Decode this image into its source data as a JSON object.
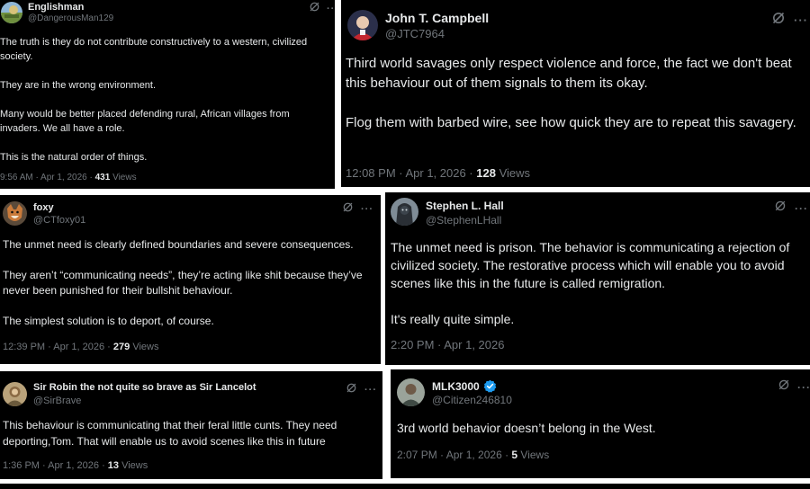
{
  "colors": {
    "background": "#000000",
    "text": "#e7e9ea",
    "muted": "#71767b",
    "verified_badge": "#1d9bf0",
    "gap": "#ffffff"
  },
  "icons": {
    "grok": "grok-icon",
    "more": "more-options-icon",
    "verified": "verified-badge-icon"
  },
  "tweets": [
    {
      "name": "Englishman",
      "handle": "@DangerousMan129",
      "paragraphs": [
        "The truth is they do not contribute constructively to a western, civilized society.",
        "They are in the wrong environment.",
        "Many would be better placed defending rural, African villages from invaders. We all have a role.",
        "This is the natural order of things."
      ],
      "time": "9:56 AM · Apr 1, 2026 · ",
      "views_count": "431",
      "views_label": " Views",
      "more": "···"
    },
    {
      "name": "John T. Campbell",
      "handle": "@JTC7964",
      "paragraphs": [
        "Third world savages only respect violence and force, the fact we don't beat this behaviour out of them signals to them its okay.",
        "Flog them with barbed wire, see how quick they are to repeat this savagery."
      ],
      "time": "12:08 PM · Apr 1, 2026 · ",
      "views_count": "128",
      "views_label": " Views",
      "more": "···"
    },
    {
      "name": "foxy",
      "handle": "@CTfoxy01",
      "paragraphs": [
        "The unmet need is clearly defined boundaries and severe consequences.",
        "They aren’t “communicating needs”, they’re acting like shit because they’ve never been punished for their bullshit behaviour.",
        "The simplest solution is to deport, of course."
      ],
      "time": "12:39 PM · Apr 1, 2026 · ",
      "views_count": "279",
      "views_label": " Views",
      "more": "···"
    },
    {
      "name": "Stephen L. Hall",
      "handle": "@StephenLHall",
      "paragraphs": [
        "The unmet need is prison.  The behavior is communicating a rejection of civilized society.  The restorative process which will enable you to avoid scenes like this in the future is called remigration.",
        "It's really quite simple."
      ],
      "time": "2:20 PM · Apr 1, 2026",
      "views_count": "",
      "views_label": "",
      "more": "···"
    },
    {
      "name": "Sir Robin the not quite so brave as Sir Lancelot",
      "handle": "@SirBrave",
      "paragraphs": [
        "This behaviour is communicating that their feral little cunts. They need deporting,Tom. That will enable us to avoid scenes like this in future"
      ],
      "time": "1:36 PM · Apr 1, 2026 · ",
      "views_count": "13",
      "views_label": " Views",
      "more": "···"
    },
    {
      "name": "MLK3000",
      "handle": "@Citizen246810",
      "verified": true,
      "paragraphs": [
        "3rd world behavior doesn’t belong in the West."
      ],
      "time": "2:07 PM · Apr 1, 2026 · ",
      "views_count": "5",
      "views_label": " Views",
      "more": "···"
    }
  ]
}
